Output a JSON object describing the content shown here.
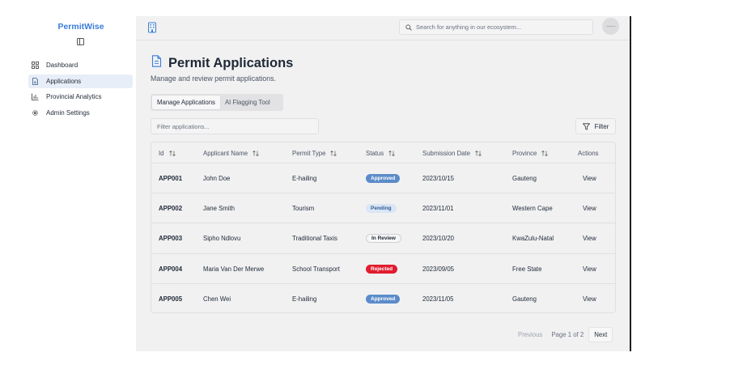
{
  "app": {
    "brand": "PermitWise"
  },
  "sidebar": {
    "items": [
      {
        "label": "Dashboard",
        "icon": "grid-icon"
      },
      {
        "label": "Applications",
        "icon": "document-icon",
        "active": true
      },
      {
        "label": "Provincial Analytics",
        "icon": "bar-chart-icon"
      },
      {
        "label": "Admin Settings",
        "icon": "gear-icon"
      }
    ]
  },
  "topbar": {
    "search_placeholder": "Search for anything in our ecosystem...",
    "avatar_text": "——"
  },
  "page": {
    "title": "Permit Applications",
    "subtitle": "Manage and review permit applications."
  },
  "tabs": [
    {
      "label": "Manage Applications",
      "active": true
    },
    {
      "label": "AI Flagging Tool",
      "active": false
    }
  ],
  "filter": {
    "placeholder": "Filter applications...",
    "button_label": "Filter"
  },
  "table": {
    "headers": [
      "Id",
      "Applicant Name",
      "Permit Type",
      "Status",
      "Submission Date",
      "Province",
      "Actions"
    ],
    "rows": [
      {
        "id": "APP001",
        "name": "John Doe",
        "type": "E-hailing",
        "status": "Approved",
        "status_kind": "approved",
        "date": "2023/10/15",
        "province": "Gauteng",
        "action": "View"
      },
      {
        "id": "APP002",
        "name": "Jane Smith",
        "type": "Tourism",
        "status": "Pending",
        "status_kind": "pending",
        "date": "2023/11/01",
        "province": "Western Cape",
        "action": "View"
      },
      {
        "id": "APP003",
        "name": "Sipho Ndlovu",
        "type": "Traditional Taxis",
        "status": "In Review",
        "status_kind": "inreview",
        "date": "2023/10/20",
        "province": "KwaZulu-Natal",
        "action": "View"
      },
      {
        "id": "APP004",
        "name": "Maria Van Der Merwe",
        "type": "School Transport",
        "status": "Rejected",
        "status_kind": "rejected",
        "date": "2023/09/05",
        "province": "Free State",
        "action": "View"
      },
      {
        "id": "APP005",
        "name": "Chen Wei",
        "type": "E-hailing",
        "status": "Approved",
        "status_kind": "approved",
        "date": "2023/11/05",
        "province": "Gauteng",
        "action": "View"
      }
    ]
  },
  "pagination": {
    "previous": "Previous",
    "info": "Page 1 of 2",
    "next": "Next"
  },
  "colors": {
    "brand": "#3b7dd8",
    "approved": "#5b8cc9",
    "rejected": "#e11d2e",
    "pending_bg": "#dbe6f4"
  }
}
